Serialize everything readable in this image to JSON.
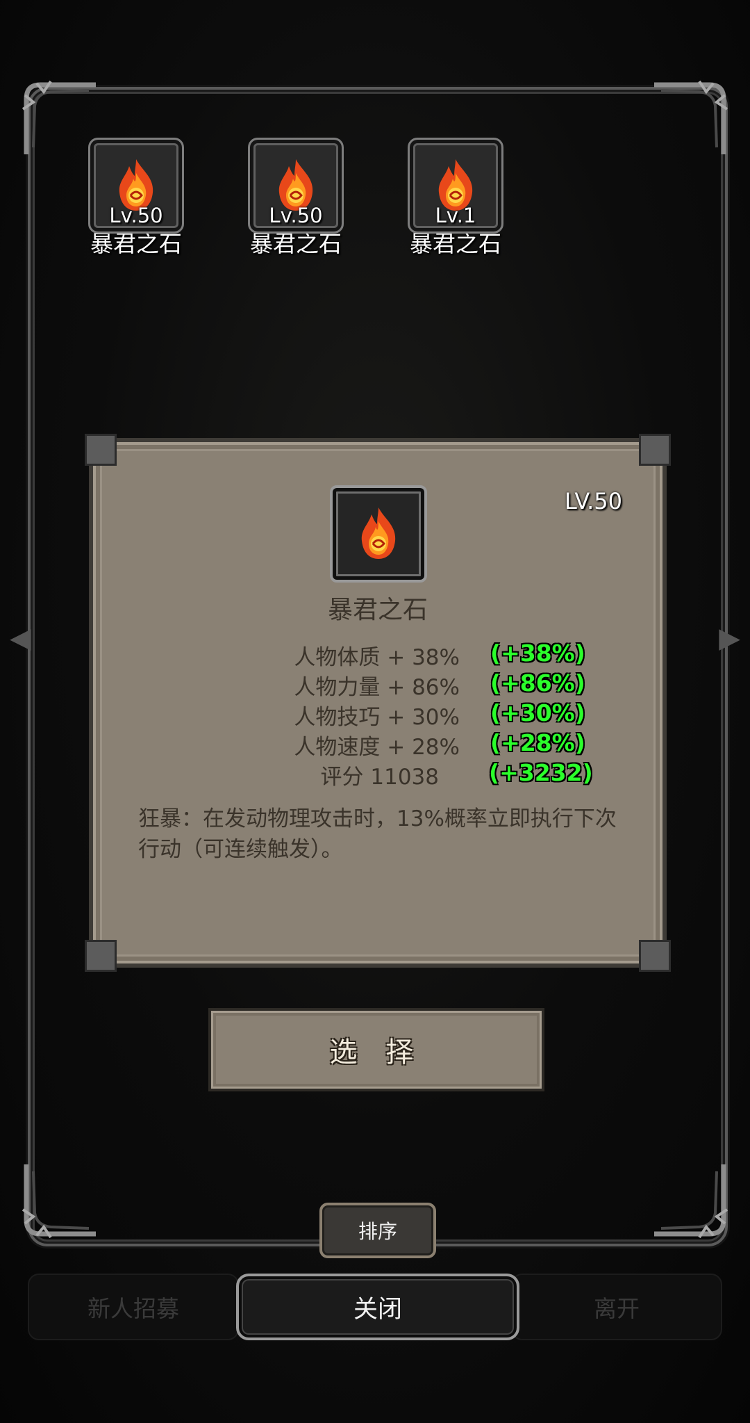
{
  "slots": [
    {
      "level": "Lv.50",
      "name": "暴君之石"
    },
    {
      "level": "Lv.50",
      "name": "暴君之石"
    },
    {
      "level": "Lv.1",
      "name": "暴君之石"
    }
  ],
  "detail": {
    "level": "LV.50",
    "name": "暴君之石",
    "stats": [
      {
        "label": "人物体质 + 38%",
        "bonus": "(+38%)"
      },
      {
        "label": "人物力量 + 86%",
        "bonus": "(+86%)"
      },
      {
        "label": "人物技巧 + 30%",
        "bonus": "(+30%)"
      },
      {
        "label": "人物速度 + 28%",
        "bonus": "(+28%)"
      },
      {
        "label": "评分 11038",
        "bonus": "(+3232)"
      }
    ],
    "skill": "狂暴：在发动物理攻击时，13%概率立即执行下次行动（可连续触发）。"
  },
  "buttons": {
    "select": "选 择",
    "sort": "排序",
    "close": "关闭",
    "recruit": "新人招募",
    "leave": "离开"
  },
  "colors": {
    "bonus_green": "#2bff2b",
    "panel_bg": "#8a8174"
  },
  "icons": {
    "item": "flame-stone-icon"
  }
}
